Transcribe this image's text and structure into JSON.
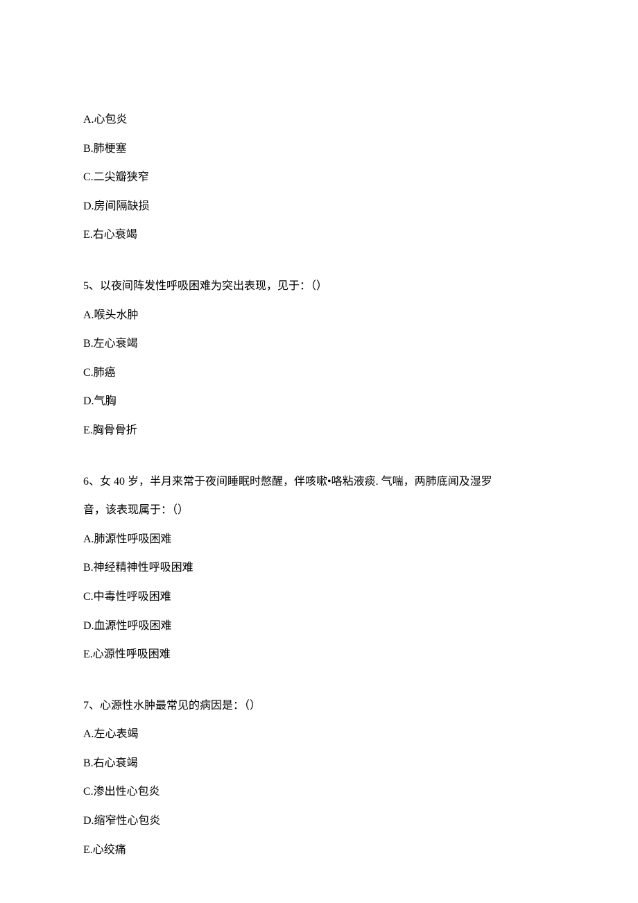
{
  "q4options": {
    "a": "A.心包炎",
    "b": "B.肺梗塞",
    "c": "C.二尖瓣狭窄",
    "d": "D.房间隔缺损",
    "e": "E.右心衰竭"
  },
  "q5": {
    "question": "5、以夜间阵发性呼吸困难为突出表现，见于：（）",
    "a": "A.喉头水肿",
    "b": "B.左心衰竭",
    "c": "C.肺癌",
    "d": "D.气胸",
    "e": "E.胸骨骨折"
  },
  "q6": {
    "question_line1": "6、女 40 岁，半月来常于夜间睡眠时憋醒，伴咳嗽•咯粘液痰. 气喘，两肺底闻及湿罗",
    "question_line2": "音，该表现属于：（）",
    "a": "A.肺源性呼吸困难",
    "b": "B.神经精神性呼吸困难",
    "c": "C.中毒性呼吸困难",
    "d": "D.血源性呼吸困难",
    "e": "E.心源性呼吸困难"
  },
  "q7": {
    "question": "7、心源性水肿最常见的病因是：（）",
    "a": "A.左心表竭",
    "b": "B.右心衰竭",
    "c": "C.渗出性心包炎",
    "d": "D.缩窄性心包炎",
    "e": "E.心绞痛"
  }
}
